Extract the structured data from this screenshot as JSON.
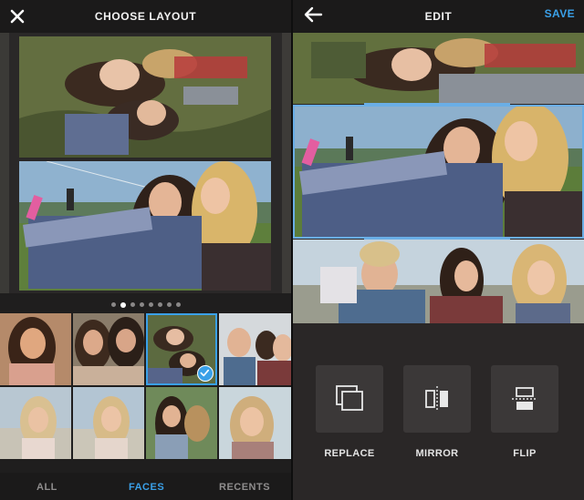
{
  "layout_screen": {
    "title": "CHOOSE LAYOUT",
    "close_icon": "close-icon",
    "page_dots": {
      "count": 8,
      "active_index": 1
    },
    "tabs": [
      {
        "label": "ALL",
        "active": false
      },
      {
        "label": "FACES",
        "active": true
      },
      {
        "label": "RECENTS",
        "active": false
      }
    ],
    "selected_thumbnail_index": 2,
    "accent_color": "#3aa0e8"
  },
  "edit_screen": {
    "title": "EDIT",
    "back_icon": "arrow-left-icon",
    "save_label": "SAVE",
    "tools": [
      {
        "label": "REPLACE",
        "icon": "replace-icon"
      },
      {
        "label": "MIRROR",
        "icon": "mirror-icon"
      },
      {
        "label": "FLIP",
        "icon": "flip-icon"
      }
    ]
  }
}
